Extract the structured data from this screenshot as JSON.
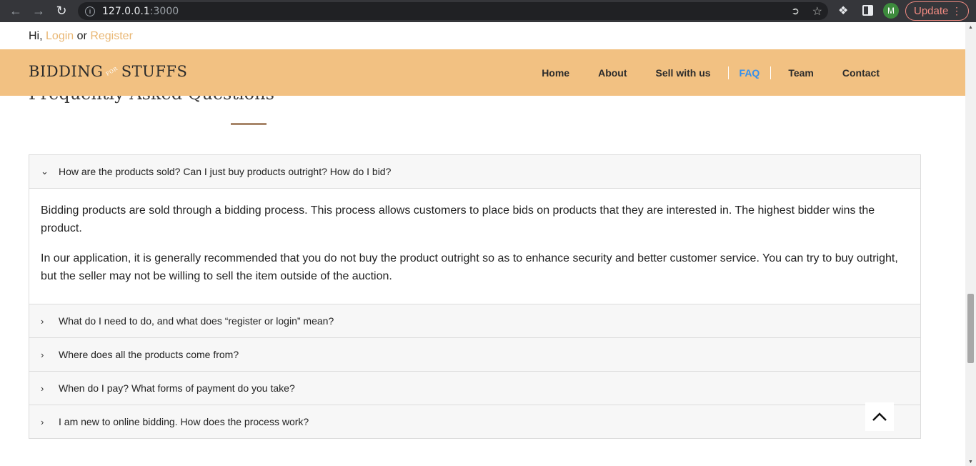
{
  "browser": {
    "url_host": "127.0.0.1",
    "url_port": ":3000",
    "profile_initial": "M",
    "update_label": "Update"
  },
  "topbar": {
    "greeting": "Hi,",
    "login": "Login",
    "or": "or",
    "register": "Register"
  },
  "header": {
    "logo_main": "BIDDING",
    "logo_for": "FOR",
    "logo_end": "STUFFS",
    "menu": [
      {
        "label": "Home"
      },
      {
        "label": "About"
      },
      {
        "label": "Sell with us"
      },
      {
        "label": "FAQ",
        "active": true
      },
      {
        "label": "Team"
      },
      {
        "label": "Contact"
      }
    ]
  },
  "faq": {
    "title": "Frequently Asked Questions",
    "items": [
      {
        "question": "How are the products sold? Can I just buy products outright? How do I bid?",
        "expanded": true,
        "answer": [
          "Bidding products are sold through a bidding process. This process allows customers to place bids on products that they are interested in. The highest bidder wins the product.",
          "In our application, it is generally recommended that you do not buy the product outright so as to enhance security and better customer service. You can try to buy outright, but the seller may not be willing to sell the item outside of the auction."
        ]
      },
      {
        "question": "What do I need to do, and what does “register or login” mean?",
        "expanded": false
      },
      {
        "question": "Where does all the products come from?",
        "expanded": false
      },
      {
        "question": "When do I pay? What forms of payment do you take?",
        "expanded": false
      },
      {
        "question": "I am new to online bidding. How does the process work?",
        "expanded": false
      }
    ]
  },
  "colors": {
    "header_bg": "#f2c182",
    "link": "#e9b774",
    "active_menu": "#3390ee"
  }
}
